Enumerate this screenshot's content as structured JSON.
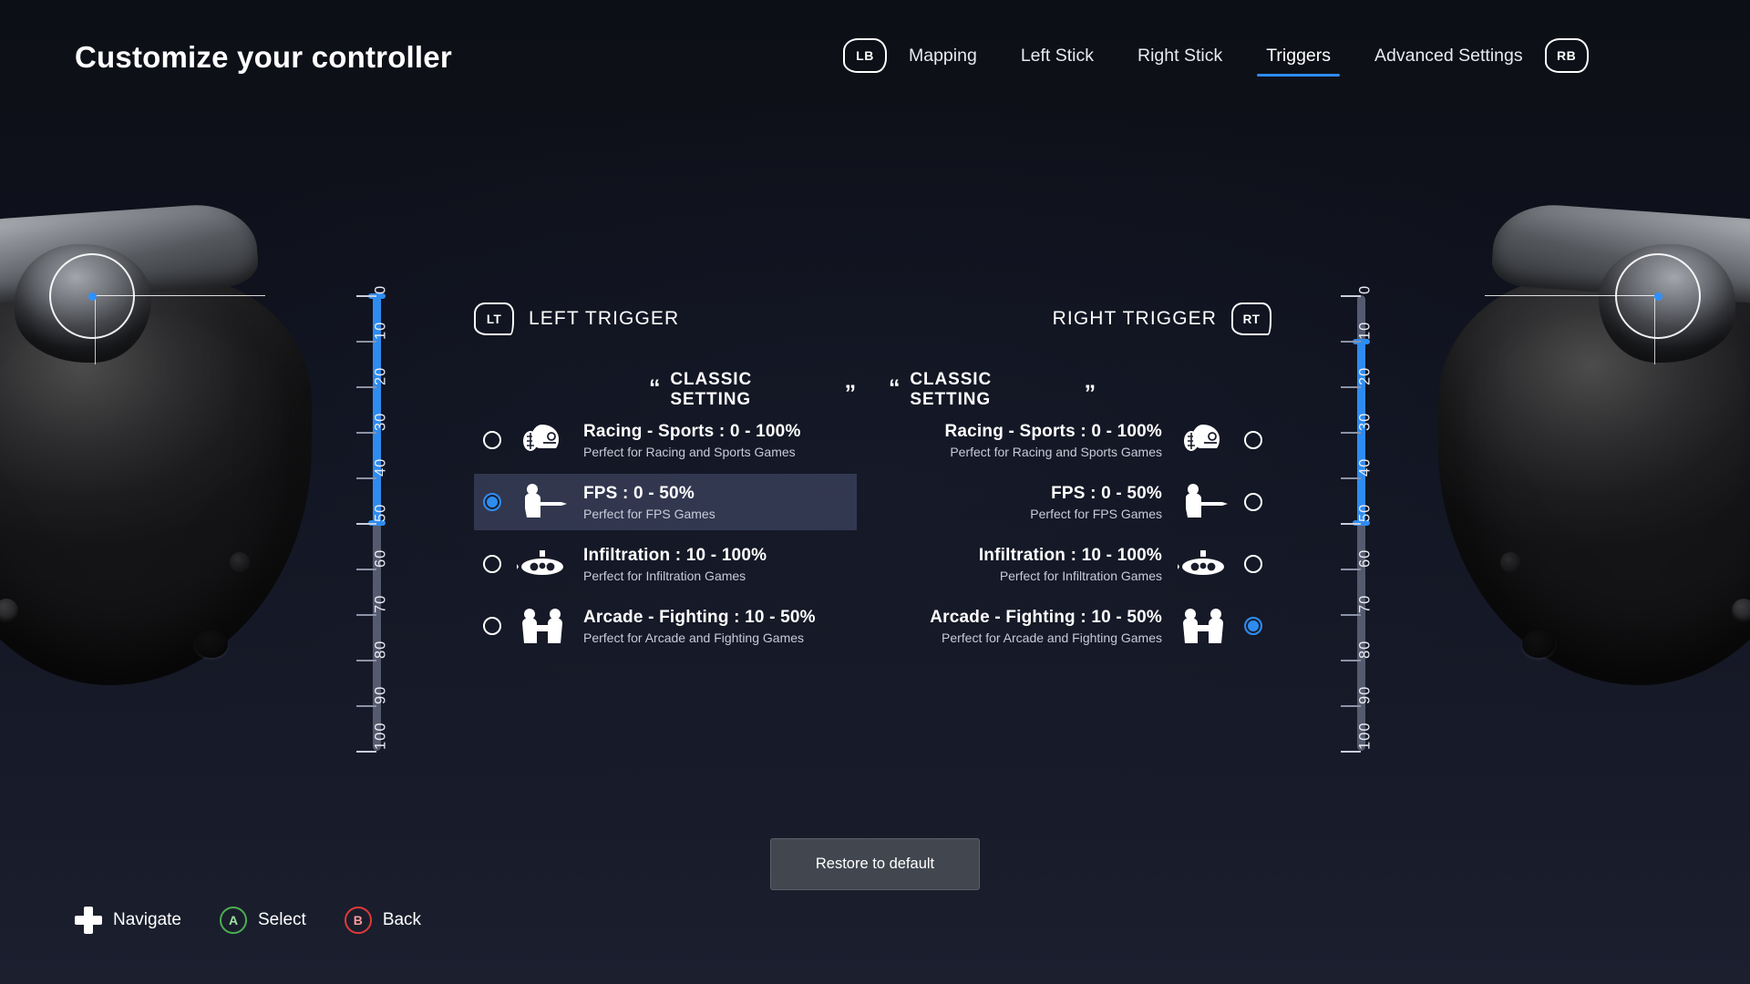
{
  "header": {
    "title": "Customize your controller",
    "bumper_left": "LB",
    "bumper_right": "RB",
    "tabs": [
      {
        "label": "Mapping",
        "active": false
      },
      {
        "label": "Left Stick",
        "active": false
      },
      {
        "label": "Right Stick",
        "active": false
      },
      {
        "label": "Triggers",
        "active": true
      },
      {
        "label": "Advanced Settings",
        "active": false
      }
    ]
  },
  "colors": {
    "accent": "#2e8cf0",
    "background": "#12141d",
    "selected_row": "#5a6094",
    "track": "#555b6e",
    "text": "#ffffff",
    "subtext": "#c7cbd8",
    "button_a": "#4caf50",
    "button_b": "#e03a3a"
  },
  "scale": {
    "ticks": [
      "0",
      "10",
      "20",
      "30",
      "40",
      "50",
      "60",
      "70",
      "80",
      "90",
      "100"
    ]
  },
  "left_trigger": {
    "badge": "LT",
    "name": "LEFT TRIGGER",
    "classic_label": "CLASSIC SETTING",
    "quote_open": "“",
    "quote_close": "”",
    "slider": {
      "min": 0,
      "max": 50,
      "unit": "%"
    },
    "options": [
      {
        "icon": "racing-helmet-icon",
        "title": "Racing - Sports : 0 - 100%",
        "subtitle": "Perfect for Racing and Sports Games",
        "selected": false
      },
      {
        "icon": "fps-shooter-icon",
        "title": "FPS : 0 - 50%",
        "subtitle": "Perfect for FPS Games",
        "selected": true
      },
      {
        "icon": "infiltration-submarine-icon",
        "title": "Infiltration : 10 - 100%",
        "subtitle": "Perfect for Infiltration Games",
        "selected": false
      },
      {
        "icon": "arcade-fighting-icon",
        "title": "Arcade - Fighting : 10 - 50%",
        "subtitle": "Perfect for Arcade and Fighting Games",
        "selected": false
      }
    ]
  },
  "right_trigger": {
    "badge": "RT",
    "name": "RIGHT TRIGGER",
    "classic_label": "CLASSIC SETTING",
    "quote_open": "“",
    "quote_close": "”",
    "slider": {
      "min": 10,
      "max": 50,
      "unit": "%"
    },
    "options": [
      {
        "icon": "racing-helmet-icon",
        "title": "Racing - Sports : 0 - 100%",
        "subtitle": "Perfect for Racing and Sports Games",
        "selected": false
      },
      {
        "icon": "fps-shooter-icon",
        "title": "FPS : 0 - 50%",
        "subtitle": "Perfect for FPS Games",
        "selected": false
      },
      {
        "icon": "infiltration-submarine-icon",
        "title": "Infiltration : 10 - 100%",
        "subtitle": "Perfect for Infiltration Games",
        "selected": false
      },
      {
        "icon": "arcade-fighting-icon",
        "title": "Arcade - Fighting : 10 - 50%",
        "subtitle": "Perfect for Arcade and Fighting Games",
        "selected": true
      }
    ]
  },
  "restore_button": {
    "label": "Restore to default"
  },
  "legend": [
    {
      "icon": "dpad-icon",
      "glyph": "",
      "label": "Navigate"
    },
    {
      "icon": "button-a-icon",
      "glyph": "A",
      "label": "Select"
    },
    {
      "icon": "button-b-icon",
      "glyph": "B",
      "label": "Back"
    }
  ]
}
